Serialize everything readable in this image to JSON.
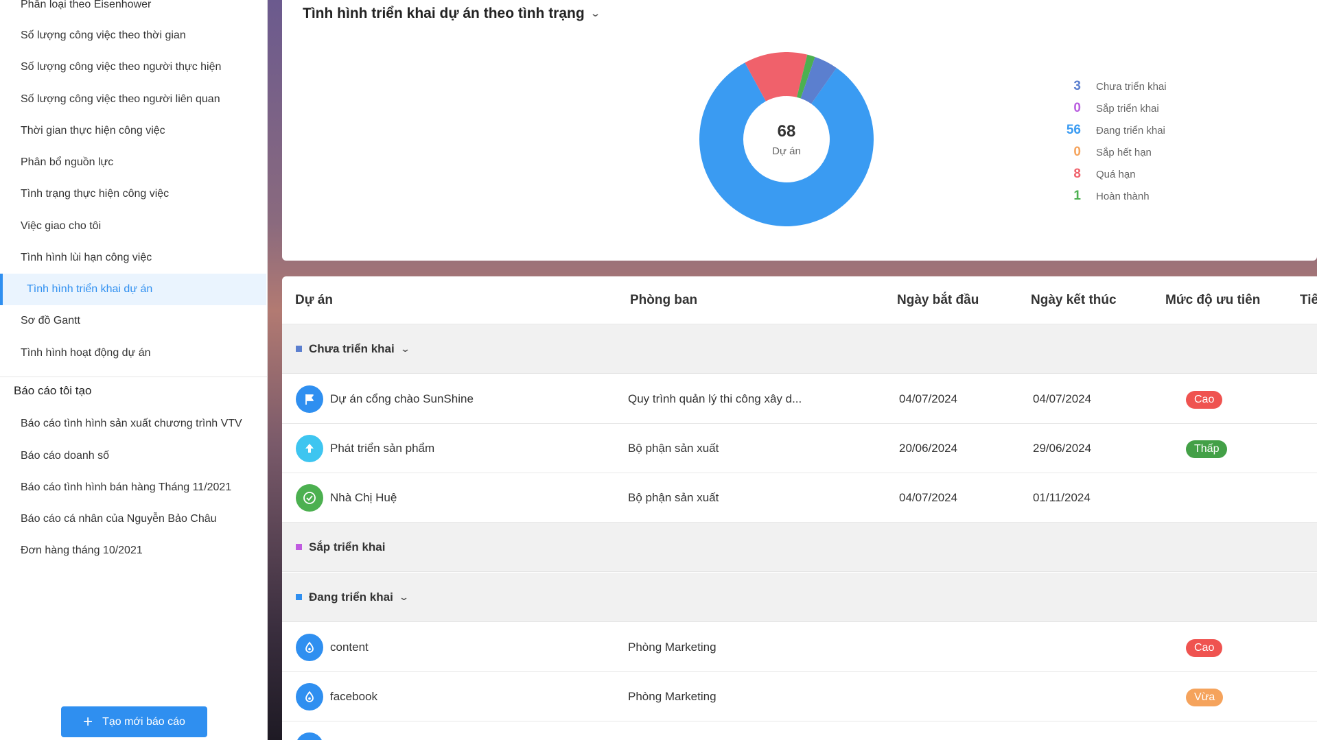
{
  "sidebar": {
    "items": [
      {
        "label": "Phân loại theo Eisenhower"
      },
      {
        "label": "Số lượng công việc theo thời gian"
      },
      {
        "label": "Số lượng công việc theo người thực hiện"
      },
      {
        "label": "Số lượng công việc theo người liên quan"
      },
      {
        "label": "Thời gian thực hiện công việc"
      },
      {
        "label": "Phân bổ nguồn lực"
      },
      {
        "label": "Tình trạng thực hiện công việc"
      },
      {
        "label": "Việc giao cho tôi"
      },
      {
        "label": "Tình hình lùi hạn công việc"
      },
      {
        "label": "Tình hình triển khai dự án"
      },
      {
        "label": "Sơ đồ Gantt"
      },
      {
        "label": "Tình hình hoạt động dự án"
      }
    ],
    "section_title": "Báo cáo tôi tạo",
    "my_reports": [
      {
        "label": "Báo cáo tình hình sản xuất chương trình VTV"
      },
      {
        "label": "Báo cáo doanh số"
      },
      {
        "label": "Báo cáo tình hình bán hàng Tháng 11/2021"
      },
      {
        "label": "Báo cáo cá nhân của Nguyễn Bảo Châu"
      },
      {
        "label": "Đơn hàng tháng 10/2021"
      }
    ],
    "create_button": "Tạo mới báo cáo"
  },
  "chart_card": {
    "title": "Tình hình triển khai dự án theo tình trạng",
    "center_value": "68",
    "center_label": "Dự án"
  },
  "chart_data": {
    "type": "pie",
    "variant": "donut",
    "categories": [
      "Chưa triển khai",
      "Sắp triển khai",
      "Đang triển khai",
      "Sắp hết hạn",
      "Quá hạn",
      "Hoàn thành"
    ],
    "values": [
      3,
      0,
      56,
      0,
      8,
      1
    ],
    "colors": [
      "#5b7fcf",
      "#b95ee0",
      "#3a9bf2",
      "#f5a35c",
      "#f0616b",
      "#4cb050"
    ],
    "legend_placement": "right",
    "total": 68
  },
  "table": {
    "headers": [
      "Dự án",
      "Phòng ban",
      "Ngày bắt đầu",
      "Ngày kết thúc",
      "Mức độ ưu tiên",
      "Tiế"
    ],
    "groups": [
      {
        "name": "Chưa triển khai",
        "color": "#5b7fcf"
      },
      {
        "name": "Sắp triển khai",
        "color": "#c05be0"
      },
      {
        "name": "Đang triển khai",
        "color": "#2f8ff0"
      }
    ],
    "rows": [
      {
        "name": "Dự án cổng chào SunShine",
        "dept": "Quy trình quản lý thi công xây d...",
        "start": "04/07/2024",
        "end": "04/07/2024",
        "priority": "Cao",
        "icon": "flag-icon",
        "icon_color": "#2f8ff0"
      },
      {
        "name": "Phát triển sản phẩm",
        "dept": "Bộ phận sản xuất",
        "start": "20/06/2024",
        "end": "29/06/2024",
        "priority": "Thấp",
        "icon": "upload-icon",
        "icon_color": "#3ec5f0"
      },
      {
        "name": "Nhà Chị Huệ",
        "dept": "Bộ phận sản xuất",
        "start": "04/07/2024",
        "end": "01/11/2024",
        "priority": "",
        "icon": "check-circle-icon",
        "icon_color": "#4cb050"
      },
      {
        "name": "content",
        "dept": "Phòng Marketing",
        "start": "",
        "end": "",
        "priority": "Cao",
        "icon": "drop-icon",
        "icon_color": "#2f8ff0"
      },
      {
        "name": "facebook",
        "dept": "Phòng Marketing",
        "start": "",
        "end": "",
        "priority": "Vừa",
        "icon": "drop-icon",
        "icon_color": "#2f8ff0"
      }
    ],
    "priority_colors": {
      "Cao": "#ef5350",
      "Thấp": "#43a047",
      "Vừa": "#f5a35c"
    }
  }
}
